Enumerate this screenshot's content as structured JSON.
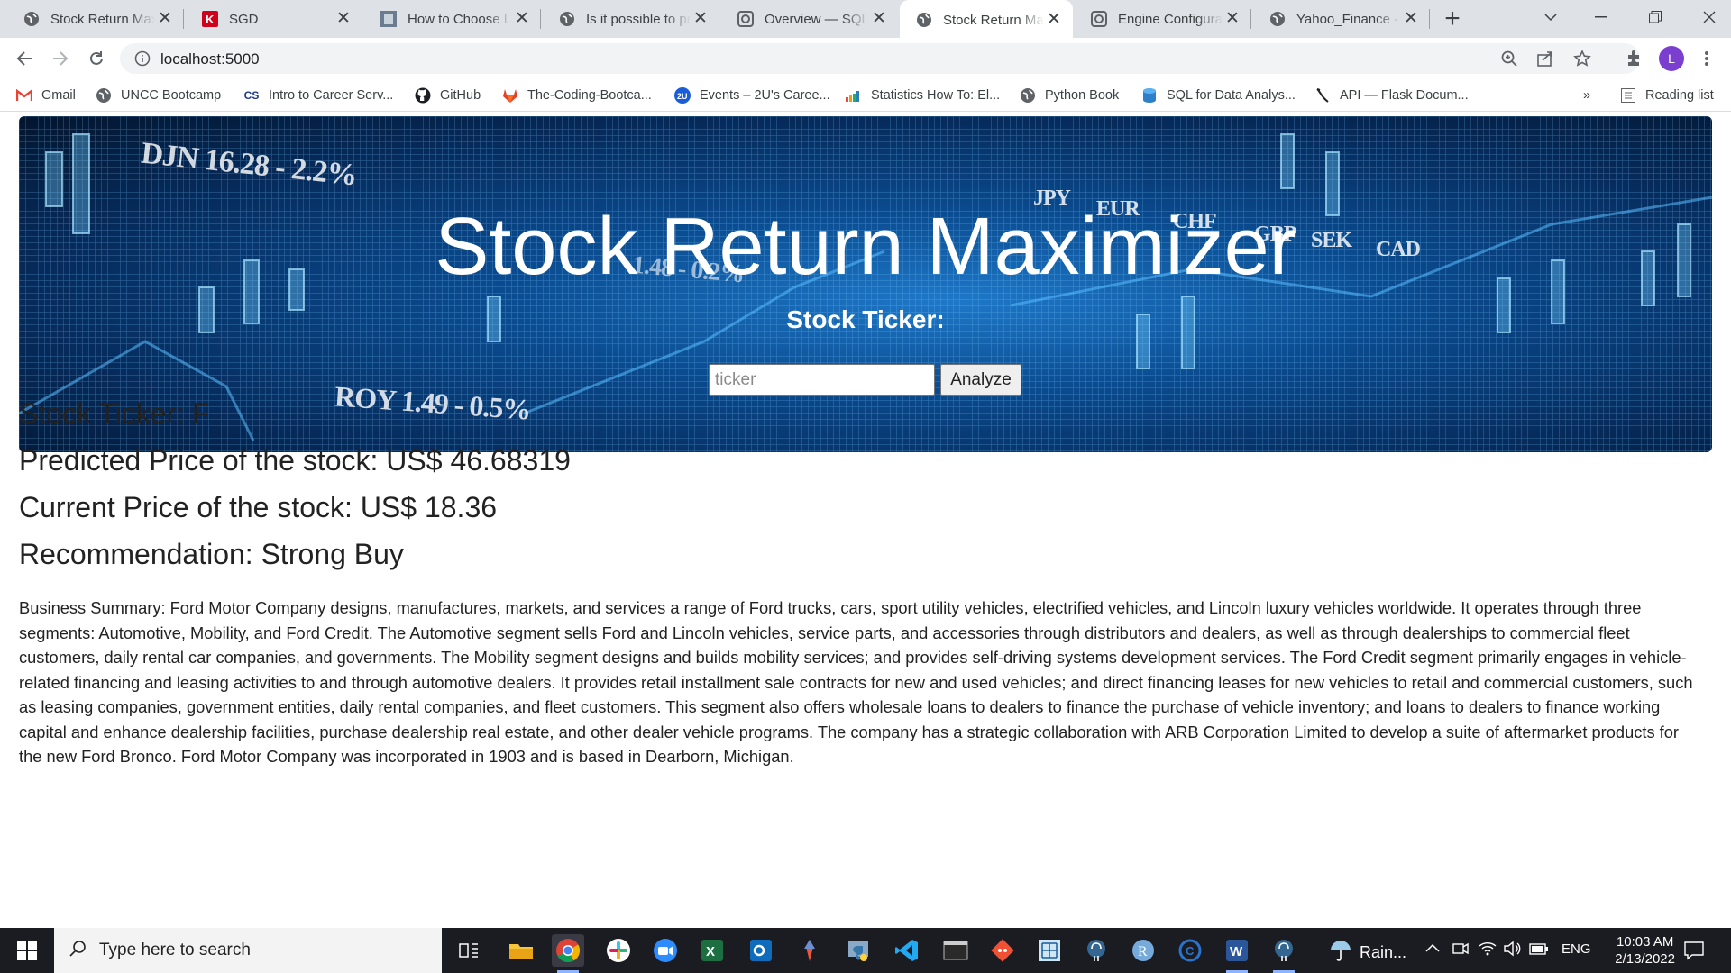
{
  "tabs": [
    {
      "title": "Stock Return Maximizer",
      "icon": "globe-icon",
      "active": false
    },
    {
      "title": "SGD",
      "icon": "k-logo-icon",
      "active": false
    },
    {
      "title": "How to Choose Loss Functions",
      "icon": "thumbnail-icon",
      "active": false
    },
    {
      "title": "Is it possible to print",
      "icon": "globe-icon",
      "active": false
    },
    {
      "title": "Overview — SQLAlchemy",
      "icon": "sqlalchemy-icon",
      "active": false
    },
    {
      "title": "Stock Return Maximizer",
      "icon": "globe-icon",
      "active": true
    },
    {
      "title": "Engine Configuration",
      "icon": "sqlalchemy-icon",
      "active": false
    },
    {
      "title": "Yahoo_Finance - Jupyter",
      "icon": "globe-icon",
      "active": false
    }
  ],
  "address_bar": {
    "url": "localhost:5000"
  },
  "profile_initial": "L",
  "bookmarks": [
    {
      "label": "Gmail",
      "icon": "gmail-icon"
    },
    {
      "label": "UNCC Bootcamp",
      "icon": "globe-icon"
    },
    {
      "label": "Intro to Career Serv...",
      "icon": "cs-icon"
    },
    {
      "label": "GitHub",
      "icon": "github-icon"
    },
    {
      "label": "The-Coding-Bootca...",
      "icon": "gitlab-icon"
    },
    {
      "label": "Events – 2U's Caree...",
      "icon": "2u-icon"
    },
    {
      "label": "Statistics How To: El...",
      "icon": "stats-icon"
    },
    {
      "label": "Python Book",
      "icon": "globe-icon"
    },
    {
      "label": "SQL for Data Analys...",
      "icon": "database-icon"
    },
    {
      "label": "API — Flask Docum...",
      "icon": "flask-icon"
    }
  ],
  "bookmarks_overflow": "»",
  "reading_list": "Reading list",
  "hero": {
    "title": "Stock Return Maximizer",
    "input_label": "Stock Ticker:",
    "input_placeholder": "ticker",
    "button_label": "Analyze",
    "bg_text": [
      "DJN 16.28 - 2.2%",
      "JPY",
      "EUR",
      "CHF",
      "GBP",
      "SEK",
      "CAD",
      "ROY 1.49 - 0.5%",
      "1.48 - 0.2%"
    ]
  },
  "results": {
    "ticker_line": "Stock Ticker: F",
    "predicted_line": "Predicted Price of the stock: US$ 46.68319",
    "current_line": "Current Price of the stock: US$ 18.36",
    "recommendation_line": "Recommendation: Strong Buy",
    "summary": "Business Summary: Ford Motor Company designs, manufactures, markets, and services a range of Ford trucks, cars, sport utility vehicles, electrified vehicles, and Lincoln luxury vehicles worldwide. It operates through three segments: Automotive, Mobility, and Ford Credit. The Automotive segment sells Ford and Lincoln vehicles, service parts, and accessories through distributors and dealers, as well as through dealerships to commercial fleet customers, daily rental car companies, and governments. The Mobility segment designs and builds mobility services; and provides self-driving systems development services. The Ford Credit segment primarily engages in vehicle-related financing and leasing activities to and through automotive dealers. It provides retail installment sale contracts for new and used vehicles; and direct financing leases for new vehicles to retail and commercial customers, such as leasing companies, government entities, daily rental companies, and fleet customers. This segment also offers wholesale loans to dealers to finance the purchase of vehicle inventory; and loans to dealers to finance working capital and enhance dealership facilities, purchase dealership real estate, and other dealer vehicle programs. The company has a strategic collaboration with ARB Corporation Limited to develop a suite of aftermarket products for the new Ford Bronco. Ford Motor Company was incorporated in 1903 and is based in Dearborn, Michigan."
  },
  "taskbar": {
    "search_placeholder": "Type here to search",
    "apps": [
      "task-view",
      "file-explorer",
      "chrome",
      "slack",
      "zoom",
      "excel",
      "outlook",
      "git-gui",
      "python",
      "vscode",
      "terminal",
      "git",
      "sourcetree",
      "postgres",
      "r",
      "coursera",
      "word",
      "pgadmin"
    ],
    "weather": "Rain...",
    "language": "ENG",
    "time": "10:03 AM",
    "date": "2/13/2022"
  },
  "colors": {
    "accent": "#1a73e8",
    "tab_strip": "#dee1e6",
    "taskbar": "#1b1b22",
    "hero_blue": "#0a4a8e",
    "avatar": "#7b3fd0"
  }
}
